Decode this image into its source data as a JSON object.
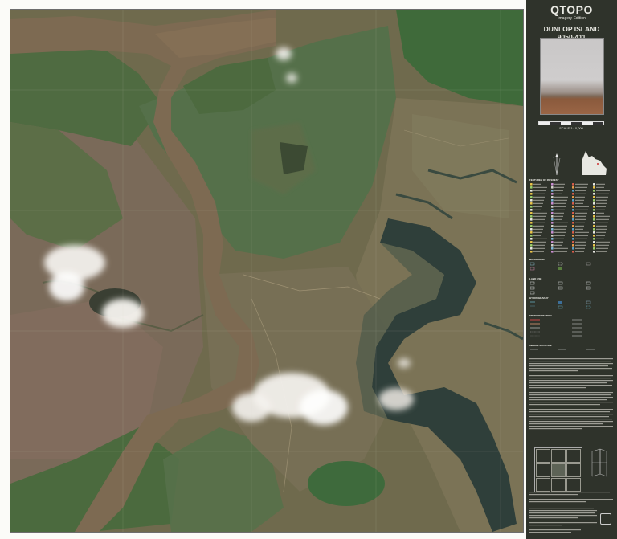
{
  "panel": {
    "brand": "QTOPO",
    "edition": "Imagery Edition",
    "sheet_name": "DUNLOP ISLAND",
    "sheet_number": "9050-411",
    "scale": "SCALE 1:10,000"
  },
  "legend": {
    "features_heading": "FEATURES OF INTEREST",
    "boundaries_heading": "BOUNDARIES",
    "land_use_heading": "LAND USE",
    "hydrography_heading": "HYDROGRAPHY",
    "transportation_heading": "TRANSPORTATION",
    "infrastructure_heading": "INFRASTRUCTURE"
  },
  "colors": {
    "panel_bg": "#2f332b",
    "river": "#7d6a52",
    "vegetation": "#4e6a3f",
    "saltpan": "#8a7466",
    "lagoon": "#2f3f3a"
  }
}
